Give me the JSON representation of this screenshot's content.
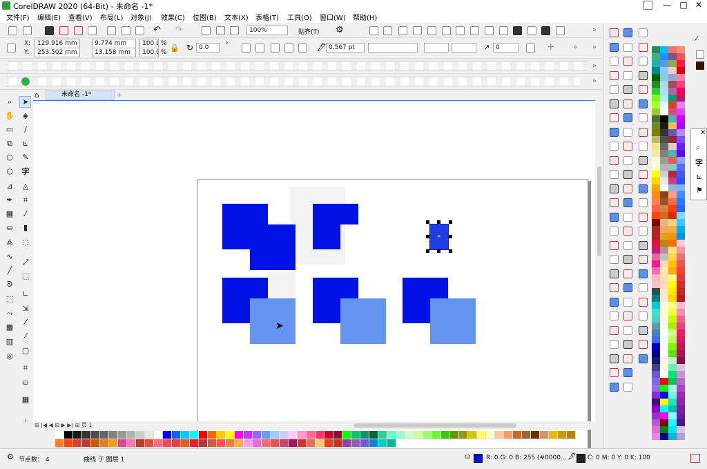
{
  "app": {
    "title": "CorelDRAW 2020 (64-Bit) - 未命名 -1*",
    "window_buttons": [
      "—",
      "□",
      "✕"
    ]
  },
  "menu": [
    "文件(F)",
    "编辑(E)",
    "查看(V)",
    "布局(L)",
    "对象(J)",
    "效果(C)",
    "位图(B)",
    "文本(X)",
    "表格(T)",
    "工具(O)",
    "窗口(W)",
    "帮助(H)"
  ],
  "standard_toolbar": {
    "zoom": "100%",
    "snap": "贴齐(T)"
  },
  "property_bar": {
    "x_label": "X:",
    "y_label": "Y:",
    "x": "129.916 mm",
    "y": "253.502 mm",
    "width": "9.774 mm",
    "height": "13.158 mm",
    "scale_w": "100.0",
    "scale_h": "100.0",
    "percent": "%",
    "rotation": "0.0",
    "outline_width": "0.567 pt",
    "corner": "0"
  },
  "document_tab": "未命名 -1*",
  "page_nav": {
    "page_label": "页 1"
  },
  "status": {
    "nodes": "节点数： 4",
    "layer": "曲线 于 图层 1",
    "fill": "R: 0 G: 0 B: 255 (#0000...",
    "outline": "C: 0 M: 0 Y: 0 K: 100"
  },
  "colors": {
    "dark_blue": "#0012e6",
    "light_blue": "#6495f0",
    "selection_blue": "#1d3ee6"
  }
}
